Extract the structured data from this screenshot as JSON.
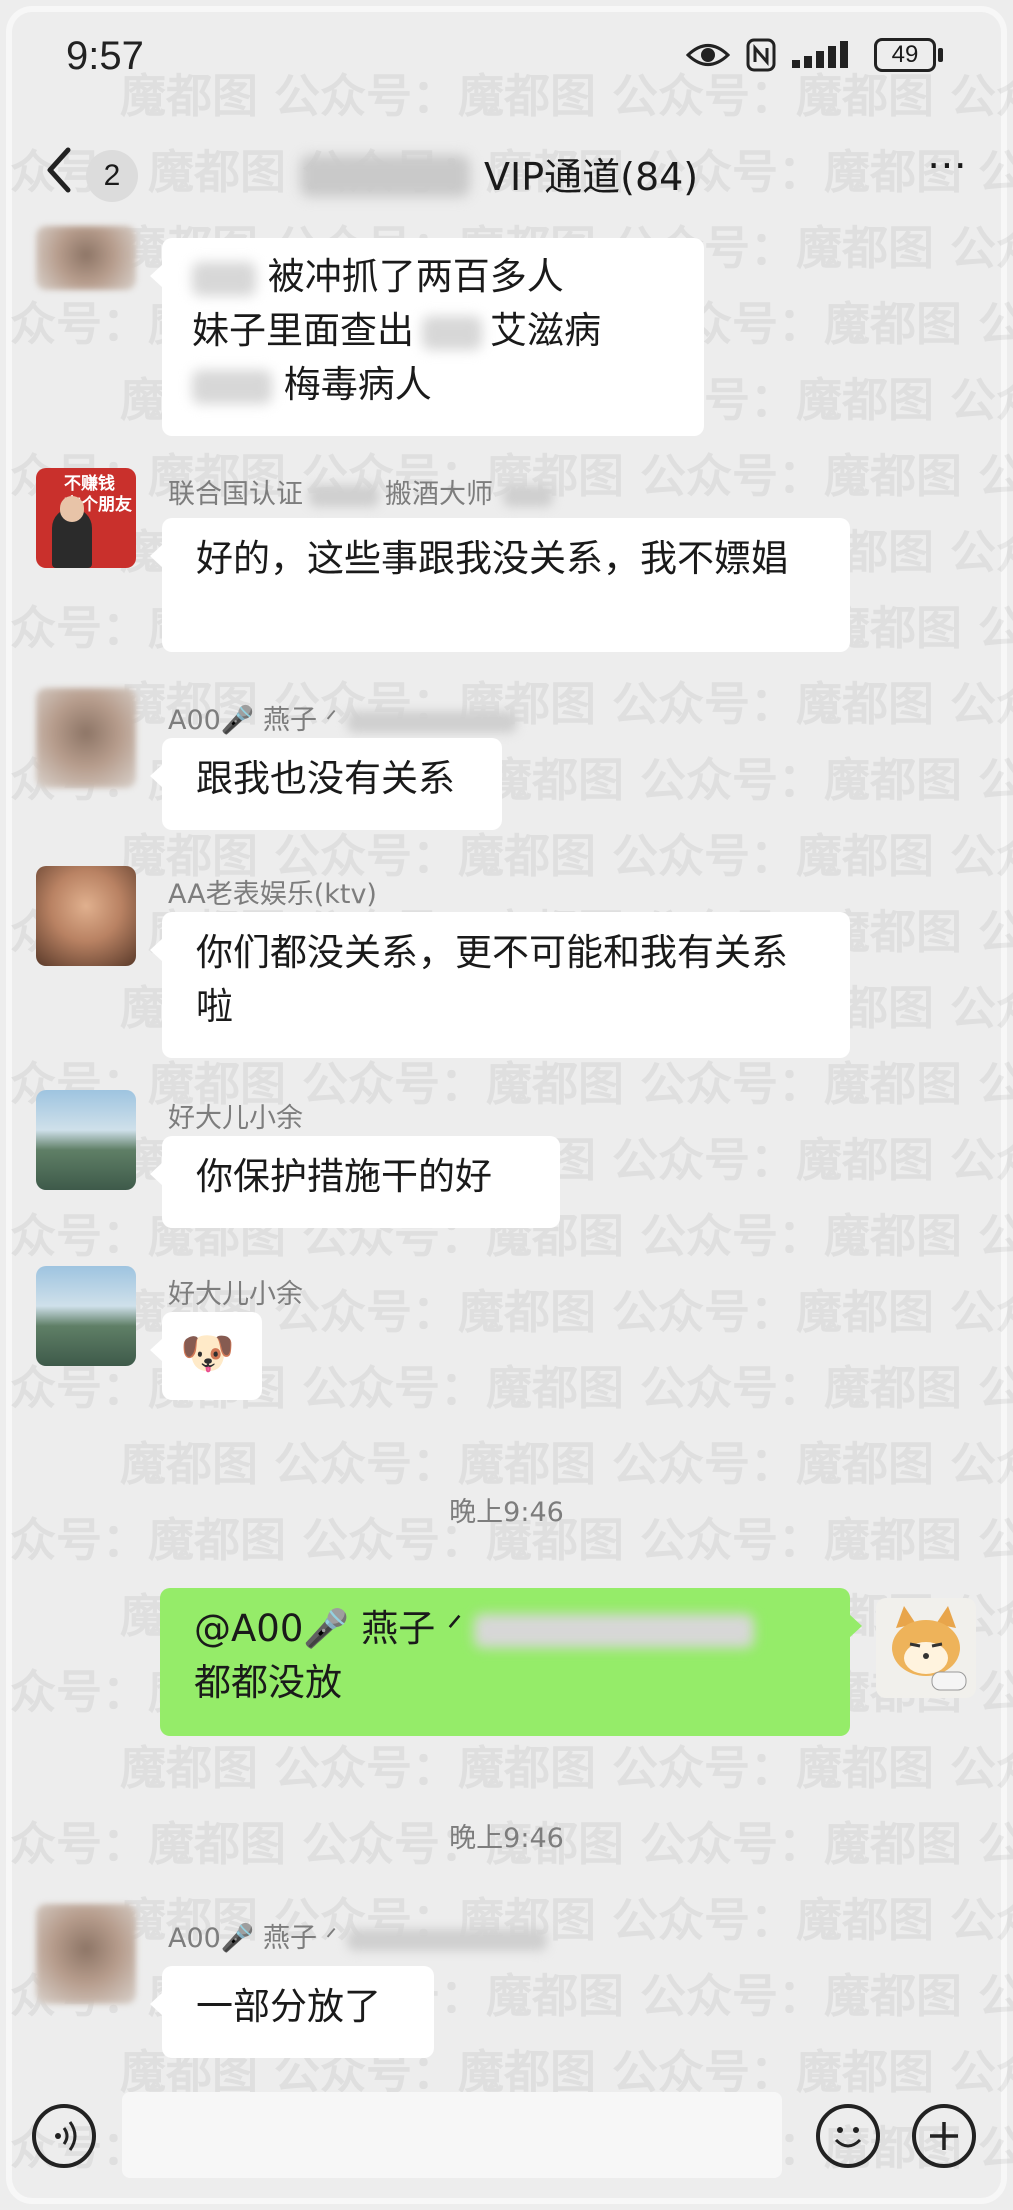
{
  "status_bar": {
    "time": "9:57",
    "battery": "49"
  },
  "header": {
    "back_count": "2",
    "title": "VIP通道(84)",
    "more": "⋯"
  },
  "avatar_texts": {
    "red_card": "不赚钱\n交个朋友"
  },
  "messages": [
    {
      "sender": "",
      "lines": [
        "被冲抓了两百多人",
        "妹子里面查出",
        "艾滋病",
        "梅毒病人"
      ]
    },
    {
      "sender": "联合国认证",
      "sender_suffix": "搬酒大师",
      "text": "好的，这些事跟我没关系，我不嫖娼"
    },
    {
      "sender": "A00🎤 燕子 ᐟ",
      "text": "跟我也没有关系"
    },
    {
      "sender": "AA老表娱乐(ktv)",
      "text": "你们都没关系，更不可能和我有关系啦"
    },
    {
      "sender": "好大儿小余",
      "text": "你保护措施干的好"
    },
    {
      "sender": "好大儿小余",
      "emoji": "🐶"
    },
    {
      "timestamp": "晚上9:46"
    },
    {
      "self": true,
      "line1": "@A00🎤 燕子 ᐟ",
      "line2": "都都没放"
    },
    {
      "timestamp": "晚上9:46"
    },
    {
      "sender": "A00🎤 燕子 ᐟ",
      "text": "一部分放了"
    }
  ],
  "watermark": {
    "line_a": "魔都图 公众号：魔都图 公众号：魔都图 公众号：魔都图",
    "line_b": "众号：魔都图 公众号：魔都图 公众号：魔都图 公众号：魔"
  }
}
